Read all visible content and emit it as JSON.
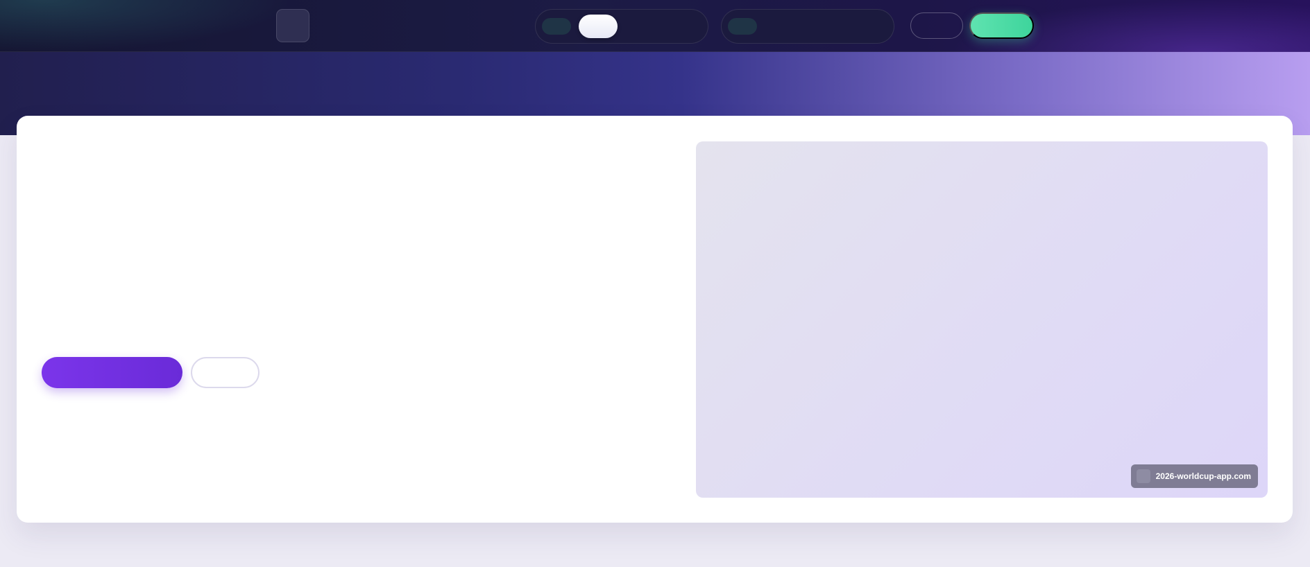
{
  "nav": {
    "logo_icon": "logo-icon",
    "segment_one": {
      "indicator_icon": "status-dot-icon"
    },
    "segment_two": {
      "indicator_icon": "status-dot-icon"
    }
  },
  "media": {
    "source_url": "2026-worldcup-app.com",
    "favicon_icon": "globe-icon"
  },
  "colors": {
    "nav_background": "#1c1b45",
    "accent_green": "#3ed49c",
    "primary_purple": "#7b35ea",
    "hero_light": "#b89ef0"
  }
}
